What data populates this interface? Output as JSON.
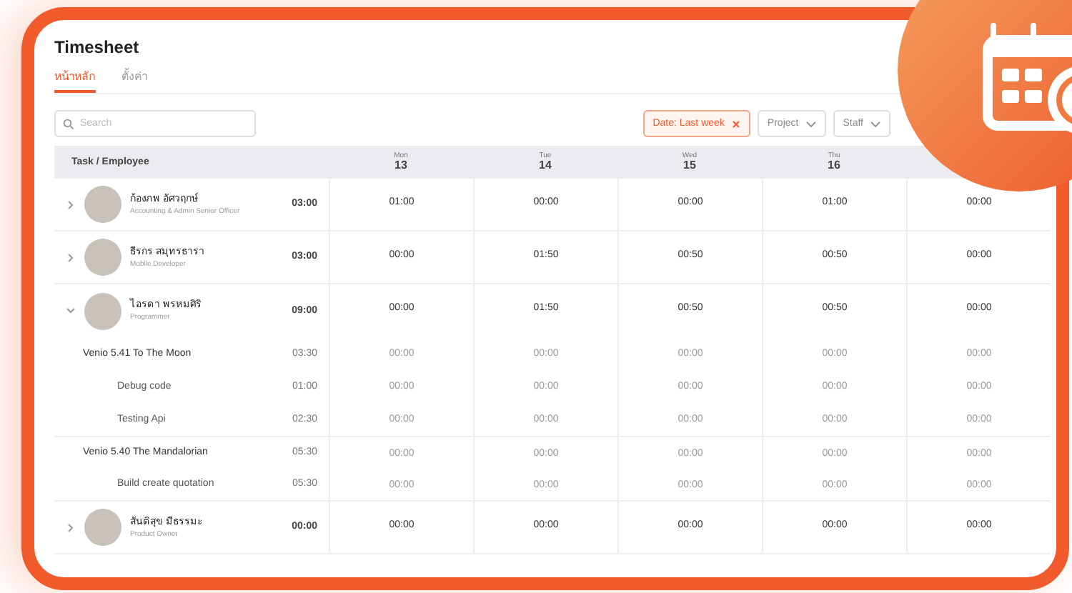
{
  "title": "Timesheet",
  "tabs": [
    {
      "label": "หน้าหลัก",
      "selected": true
    },
    {
      "label": "ตั้งค่า",
      "selected": false
    }
  ],
  "search": {
    "placeholder": "Search"
  },
  "filters": [
    {
      "kind": "chip",
      "label": "Date: Last week"
    },
    {
      "kind": "dropdown",
      "label": "Project"
    },
    {
      "kind": "dropdown",
      "label": "Staff"
    }
  ],
  "table": {
    "heading": "Task / Employee",
    "days": [
      {
        "weekday": "Mon",
        "day": "13"
      },
      {
        "weekday": "Tue",
        "day": "14"
      },
      {
        "weekday": "Wed",
        "day": "15"
      },
      {
        "weekday": "Thu",
        "day": "16"
      }
    ],
    "rows": [
      {
        "name": "ก้องภพ อัศวฤกษ์",
        "role": "Accounting & Admin Senior Officer",
        "total": "03:00",
        "cells": [
          "01:00",
          "00:00",
          "00:00",
          "01:00",
          "00:00"
        ],
        "expanded": false
      },
      {
        "name": "ธีรกร สมุทรธารา",
        "role": "Mobile Developer",
        "total": "03:00",
        "cells": [
          "00:00",
          "01:50",
          "00:50",
          "00:50",
          "00:00"
        ],
        "expanded": false
      },
      {
        "name": "ไอรดา พรหมศิริ",
        "role": "Programmer",
        "total": "09:00",
        "cells": [
          "00:00",
          "01:50",
          "00:50",
          "00:50",
          "00:00"
        ],
        "expanded": true,
        "children": [
          {
            "name": "Venio 5.41 To The Moon",
            "total": "03:30",
            "cells": [
              "00:00",
              "00:00",
              "00:00",
              "00:00",
              "00:00"
            ],
            "children": [
              {
                "name": "Debug code",
                "total": "01:00",
                "cells": [
                  "00:00",
                  "00:00",
                  "00:00",
                  "00:00",
                  "00:00"
                ]
              },
              {
                "name": "Testing Api",
                "total": "02:30",
                "cells": [
                  "00:00",
                  "00:00",
                  "00:00",
                  "00:00",
                  "00:00"
                ]
              }
            ]
          },
          {
            "name": "Venio 5.40 The Mandalorian",
            "total": "05:30",
            "cells": [
              "00:00",
              "00:00",
              "00:00",
              "00:00",
              "00:00"
            ],
            "children": [
              {
                "name": "Build create quotation",
                "total": "05:30",
                "cells": [
                  "00:00",
                  "00:00",
                  "00:00",
                  "00:00",
                  "00:00"
                ]
              }
            ]
          }
        ]
      },
      {
        "name": "สันติสุข มีธรรมะ",
        "role": "Product Owner",
        "total": "00:00",
        "cells": [
          "00:00",
          "00:00",
          "00:00",
          "00:00",
          "00:00"
        ],
        "expanded": false
      }
    ]
  }
}
